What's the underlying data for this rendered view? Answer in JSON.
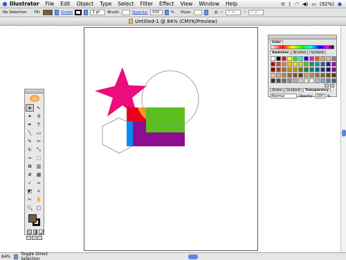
{
  "menubar": {
    "app_name": "Illustrator",
    "items": [
      "File",
      "Edit",
      "Object",
      "Type",
      "Select",
      "Filter",
      "Effect",
      "View",
      "Window",
      "Help"
    ],
    "battery": "(92%)",
    "clock": ""
  },
  "controlbar": {
    "selection": "No Selection",
    "fill_label": "Fill:",
    "stroke_label": "Stroke",
    "stroke_weight": "1 pt",
    "brush_label": "Brush:",
    "opacity_label": "Opacity:",
    "opacity_value": "100",
    "percent": "%",
    "style_label": "Style:",
    "x_value": "0 pt",
    "y_value": "0 pt",
    "fill_color": "#7a5a3a"
  },
  "titlebar": {
    "title": "Untitled-1 @ 84% (CMYK/Preview)"
  },
  "statusbar": {
    "zoom": "84%",
    "status_text": "Toggle Direct Selection"
  },
  "toolbox": {
    "tools": [
      "arrow-icon",
      "direct-select-icon",
      "magic-wand-icon",
      "lasso-icon",
      "pen-icon",
      "type-icon",
      "line-icon",
      "rectangle-icon",
      "brush-icon",
      "pencil-icon",
      "rotate-icon",
      "scale-icon",
      "warp-icon",
      "free-transform-icon",
      "symbol-icon",
      "graph-icon",
      "mesh-icon",
      "gradient-icon",
      "eyedropper-icon",
      "blend-icon",
      "live-paint-icon",
      "slice-icon",
      "scissors-icon",
      "hand-icon",
      "zoom-icon",
      "page-icon"
    ],
    "glyphs": [
      "➤",
      "↖",
      "✦",
      "ϑ",
      "✒",
      "T",
      "╲",
      "▭",
      "✎",
      "✏",
      "↻",
      "⤡",
      "≈",
      "⬚",
      "✿",
      "▥",
      "#",
      "▦",
      "✓",
      "∞",
      "◩",
      "⌗",
      "✂",
      "✋",
      "🔍",
      "▢"
    ],
    "fill_color": "#7a5a3a",
    "stroke_color": "#111111"
  },
  "colorpanel": {
    "color_tab": "Color",
    "swatch_tabs": [
      "Swatches",
      "Brushes",
      "Symbols"
    ],
    "transparency_tabs": [
      "Stroke",
      "Gradient",
      "Transparency"
    ],
    "blend_mode": "Normal",
    "opacity_label": "Opacity:",
    "opacity_value": "100",
    "opacity_unit": "%",
    "swatch_colors": [
      "#ffffff",
      "#000000",
      "#ff0000",
      "#ffff00",
      "#00ff00",
      "#00ffff",
      "#0000ff",
      "#ff00ff",
      "#e06020",
      "#f0a030",
      "#c0c0c0",
      "#808080",
      "#c00000",
      "#e04020",
      "#f08020",
      "#f0c000",
      "#f8e000",
      "#c0e000",
      "#60c000",
      "#00a040",
      "#00a0a0",
      "#0060c0",
      "#4000a0",
      "#a000a0",
      "#800000",
      "#a04020",
      "#c06020",
      "#c09000",
      "#a0a000",
      "#608000",
      "#208000",
      "#008060",
      "#006080",
      "#004080",
      "#200080",
      "#800080",
      "#f0c0a0",
      "#e0a080",
      "#c08060",
      "#a06040",
      "#805030",
      "#604020",
      "#c8a078",
      "#b08860",
      "#987048",
      "#806038",
      "#684828",
      "#503818",
      "#303030",
      "#505050",
      "#707070",
      "#909090",
      "#b0b0b0",
      "#d0d0d0",
      "#e8e8e8",
      "#f8f8f8",
      "#a0c0e0",
      "#80a0c0",
      "#6080a0",
      "#406080"
    ]
  },
  "shape_colors": {
    "star": "#ec0c7c",
    "red_rect": "#e8001c",
    "orange": "#ff9a1c",
    "green_rect": "#5cbf20",
    "purple_rect": "#8e0d90",
    "blue_strip": "#0a8af0"
  }
}
